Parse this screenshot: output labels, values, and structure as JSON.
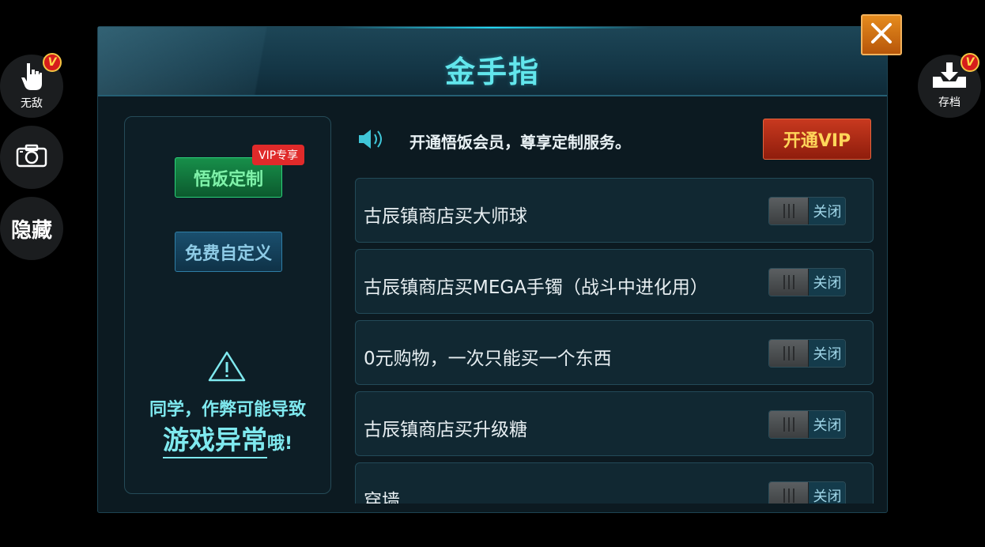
{
  "side_left": {
    "invincible": {
      "label": "无敌",
      "badge": "V"
    },
    "hide": {
      "label": "隐藏"
    }
  },
  "side_right": {
    "save": {
      "label": "存档",
      "badge": "V"
    }
  },
  "dialog": {
    "title": "金手指",
    "left": {
      "custom_button": "悟饭定制",
      "vip_tag": "VIP专享",
      "free_button": "免费自定义",
      "warning_line1": "同学，作弊可能导致",
      "warning_emphasis": "游戏异常",
      "warning_suffix": "哦!"
    },
    "notice": "开通悟饭会员，尊享定制服务。",
    "vip_button": "开通VIP",
    "cheats": [
      {
        "label": "古辰镇商店买大师球",
        "state": "关闭"
      },
      {
        "label": "古辰镇商店买MEGA手镯（战斗中进化用）",
        "state": "关闭"
      },
      {
        "label": "0元购物，一次只能买一个东西",
        "state": "关闭"
      },
      {
        "label": "古辰镇商店买升级糖",
        "state": "关闭"
      },
      {
        "label": "穿墙",
        "state": "关闭"
      }
    ]
  },
  "colors": {
    "title": "#62e6ec",
    "accent_green": "#178f4a",
    "vip_red": "#c8391f",
    "close_orange": "#e58b1d"
  }
}
